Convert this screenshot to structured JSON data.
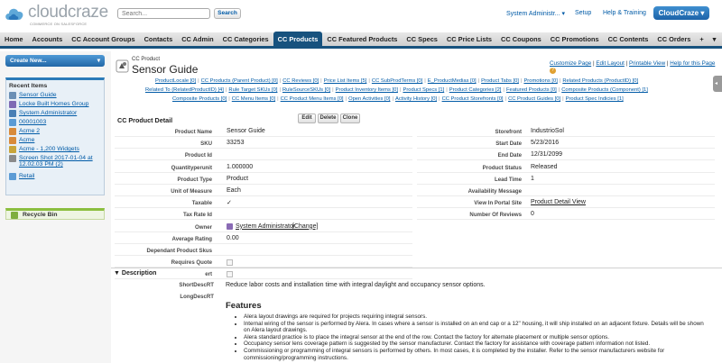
{
  "header": {
    "logo_name": "cloudcraze",
    "logo_tagline": "COMMERCE ON SALESFORCE",
    "search_placeholder": "Search...",
    "search_button": "Search",
    "user_menu": "System Administr... ▾",
    "setup": "Setup",
    "help": "Help & Training",
    "app_switcher": "CloudCraze ▾"
  },
  "tabs": [
    "Home",
    "Accounts",
    "CC Account Groups",
    "Contacts",
    "CC Admin",
    "CC Categories",
    "CC Products",
    "CC Featured Products",
    "CC Specs",
    "CC Price Lists",
    "CC Coupons",
    "CC Promotions",
    "CC Contents",
    "CC Orders",
    "+",
    "▾"
  ],
  "active_tab": "CC Products",
  "sidebar": {
    "create_new": "Create New...",
    "create_caret": "▾",
    "recent_title": "Recent Items",
    "recent_items": [
      {
        "label": "Sensor Guide",
        "icon_color": "#6b8fb5"
      },
      {
        "label": "Locke Built Homes Group",
        "icon_color": "#7f6bb5"
      },
      {
        "label": "System Administrator",
        "icon_color": "#4a7fb5"
      },
      {
        "label": "00001003",
        "icon_color": "#5b9bd5"
      },
      {
        "label": "Acme 2",
        "icon_color": "#d88a3a"
      },
      {
        "label": "Acme",
        "icon_color": "#d88a3a"
      },
      {
        "label": "Acme - 1,200 Widgets",
        "icon_color": "#c9a53a"
      },
      {
        "label": "Screen Shot 2017-01-04 at\n12.02.03 PM (2)",
        "icon_color": "#8a8a8a"
      },
      {
        "label": "Retail",
        "icon_color": "#5b9bd5"
      }
    ],
    "recycle_bin": "Recycle Bin"
  },
  "record": {
    "type": "CC Product",
    "name": "Sensor Guide",
    "top_links": [
      "Customize Page",
      "Edit Layout",
      "Printable View",
      "Help for this Page"
    ],
    "help_glyph": "?"
  },
  "related_lists": [
    [
      "ProductLocale [0]",
      "CC Products (Parent Product) [0]",
      "CC Reviews [0]",
      "Price List Items [5]",
      "CC SubProdTerms [0]",
      "E_ProductMedias [0]",
      "Product Tabs [0]",
      "Promotions [0]",
      "Related Products (ProductID) [0]"
    ],
    [
      "Related To (RelatedProductID) [4]",
      "Rule Target SKUs [0]",
      "RuleSourceSKUs [0]",
      "Product Inventory Items [0]",
      "Product Specs [1]",
      "Product Categories [2]",
      "Featured Products [0]",
      "Composite Products (Component) [1]"
    ],
    [
      "Composite Products [0]",
      "CC Menu Items [0]",
      "CC Product Menu Items [0]",
      "Open Activities [0]",
      "Activity History [0]",
      "CC Product Storefronts [0]",
      "CC Product Guides [0]",
      "Product Spec Indicies [1]"
    ]
  ],
  "detail": {
    "section_title": "CC Product Detail",
    "buttons": [
      "Edit",
      "Delete",
      "Clone"
    ],
    "left": [
      {
        "label": "Product Name",
        "value": "Sensor Guide"
      },
      {
        "label": "SKU",
        "value": "33253"
      },
      {
        "label": "Product Id",
        "value": ""
      },
      {
        "label": "Quantityperunit",
        "value": "1.000000"
      },
      {
        "label": "Product Type",
        "value": "Product"
      },
      {
        "label": "Unit of Measure",
        "value": "Each"
      },
      {
        "label": "Taxable",
        "value": "✓"
      },
      {
        "label": "Tax Rate Id",
        "value": ""
      },
      {
        "label": "Owner",
        "value": "System Administrator",
        "extra": "[Change]"
      },
      {
        "label": "Average Rating",
        "value": "0.00"
      },
      {
        "label": "Dependant Product Skus",
        "value": ""
      },
      {
        "label": "Requires Quote",
        "value": ""
      },
      {
        "label": "ert",
        "value": ""
      }
    ],
    "right": [
      {
        "label": "Storefront",
        "value": "IndustrioSol"
      },
      {
        "label": "Start Date",
        "value": "5/23/2016"
      },
      {
        "label": "End Date",
        "value": "12/31/2099"
      },
      {
        "label": "Product Status",
        "value": "Released"
      },
      {
        "label": "Lead Time",
        "value": "1"
      },
      {
        "label": "Availability Message",
        "value": ""
      },
      {
        "label": "View In Portal Site",
        "value": "Product Detail View"
      },
      {
        "label": "Number Of Reviews",
        "value": "0"
      }
    ]
  },
  "description": {
    "title": "Description",
    "short_label": "ShortDescRT",
    "short_value": "Reduce labor costs and installation time with integral daylight and occupancy sensor options.",
    "long_label": "LongDescRT",
    "features_heading": "Features",
    "features": [
      "Alera layout drawings are required for projects requiring integral sensors.",
      "Internal wiring of the sensor is performed by Alera. In cases where a sensor is installed on an end cap or a 12\" housing, it will ship installed on an adjacent fixture. Details will be shown on Alera layout drawings.",
      "Alera standard practice is to place the integral sensor at the end of the row. Contact the factory for alternate placement or multiple sensor options.",
      "Occupancy sensor lens coverage pattern is suggested by the sensor manufacturer. Contact the factory for assistance with coverage pattern information not listed.",
      "Commissioning or programming of integral sensors is performed by others. In most cases, it is completed by the installer. Refer to the sensor manufacturers website for commissioning/programming instructions."
    ]
  }
}
